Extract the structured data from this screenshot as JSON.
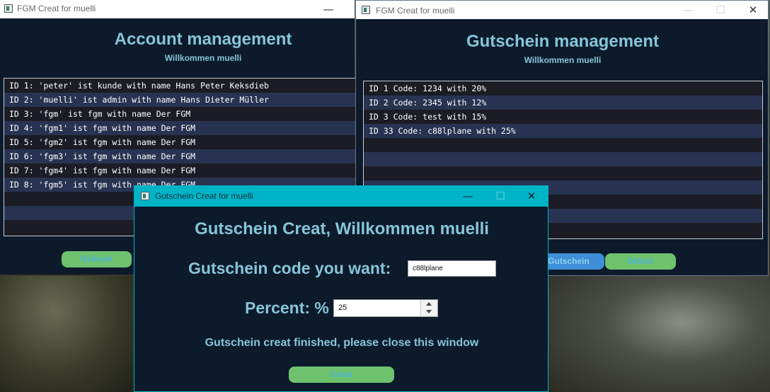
{
  "account_window": {
    "titlebar": {
      "title": "FGM Creat for muelli",
      "minimize": "—"
    },
    "heading": "Account management",
    "subheading": "Willkommen muelli",
    "rows": [
      "ID 1: 'peter' ist kunde with name Hans Peter Keksdieb",
      "ID 2: 'muelli' ist admin with name Hans Dieter Müller",
      "ID 3: 'fgm' ist fgm with name Der FGM",
      "ID 4: 'fgm1' ist fgm with name Der FGM",
      "ID 5: 'fgm2' ist fgm with name Der FGM",
      "ID 6: 'fgm3' ist fgm with name Der FGM",
      "ID 7: 'fgm4' ist fgm with name Der FGM",
      "ID 8: 'fgm5' ist fgm with name Der FGM"
    ],
    "refresh_label": "Refresh"
  },
  "gutschein_window": {
    "titlebar": {
      "title": "FGM Creat for muelli",
      "minimize": "—",
      "maximize": "☐",
      "close": "✕"
    },
    "heading": "Gutschein management",
    "subheading": "Willkommen muelli",
    "rows": [
      "ID 1 Code: 1234 with 20%",
      "ID 2 Code: 2345 with 12%",
      "ID 3 Code: test with 15%",
      "ID 33 Code: c88lplane with 25%"
    ],
    "gutschein_label": "Gutschein",
    "delete_label": "Delect"
  },
  "dialog": {
    "titlebar": {
      "title": "Gutschein Creat for muelli",
      "minimize": "—",
      "maximize": "☐",
      "close": "✕"
    },
    "heading": "Gutschein Creat, Willkommen muelli",
    "code_label": "Gutschein code you want:",
    "code_value": "c88lplane",
    "percent_label": "Percent: %",
    "percent_value": "25",
    "status": "Gutschein creat finished, please close this window",
    "creat_label": "Creat"
  },
  "colors": {
    "window_bg": "#0c1a2b",
    "heading": "#86c5d7",
    "button_green": "#6ec26e",
    "button_blue": "#3f8fd8",
    "dialog_titlebar": "#00b4c8"
  }
}
